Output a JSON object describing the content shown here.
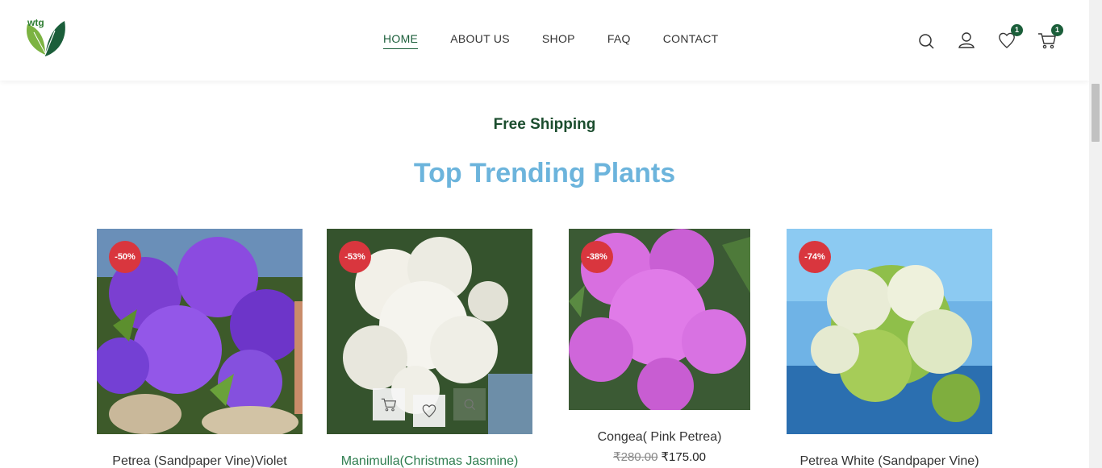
{
  "header": {
    "nav": [
      {
        "label": "HOME",
        "active": true
      },
      {
        "label": "ABOUT US",
        "active": false
      },
      {
        "label": "SHOP",
        "active": false
      },
      {
        "label": "FAQ",
        "active": false
      },
      {
        "label": "CONTACT",
        "active": false
      }
    ],
    "logo_text": "wtg",
    "wishlist_count": "1",
    "cart_count": "1"
  },
  "banner": {
    "free_shipping": "Free Shipping",
    "section_title": "Top Trending Plants"
  },
  "products": [
    {
      "name": "Petrea (Sandpaper Vine)Violet",
      "discount": "-50%",
      "image": "purple petrea flowers"
    },
    {
      "name": "Manimulla(Christmas Jasmine)",
      "discount": "-53%",
      "image": "white jasmine flowers"
    },
    {
      "name": "Congea( Pink Petrea)",
      "discount": "-38%",
      "old_price": "₹280.00",
      "new_price": "₹175.00",
      "image": "pink congea bracts"
    },
    {
      "name": "Petrea White (Sandpaper Vine)",
      "discount": "-74%",
      "image": "white petrea under blue sky"
    }
  ],
  "colors": {
    "brand_green": "#1b5e3a",
    "title_blue": "#6cb4dc",
    "discount_red": "#d9363e"
  }
}
